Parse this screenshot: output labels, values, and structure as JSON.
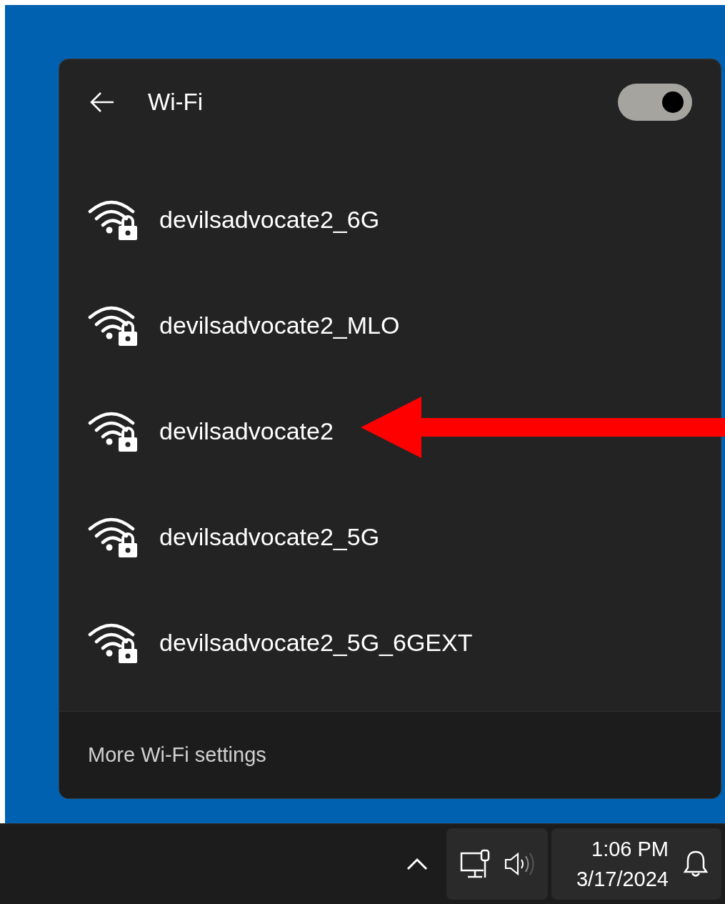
{
  "wifi_panel": {
    "title": "Wi-Fi",
    "wifi_on": true,
    "networks": [
      {
        "name": "devilsadvocate2_6G"
      },
      {
        "name": "devilsadvocate2_MLO"
      },
      {
        "name": "devilsadvocate2"
      },
      {
        "name": "devilsadvocate2_5G"
      },
      {
        "name": "devilsadvocate2_5G_6GEXT"
      }
    ],
    "footer_link": "More Wi-Fi settings"
  },
  "annotation": {
    "kind": "arrow"
  },
  "taskbar": {
    "time": "1:06 PM",
    "date": "3/17/2024"
  }
}
